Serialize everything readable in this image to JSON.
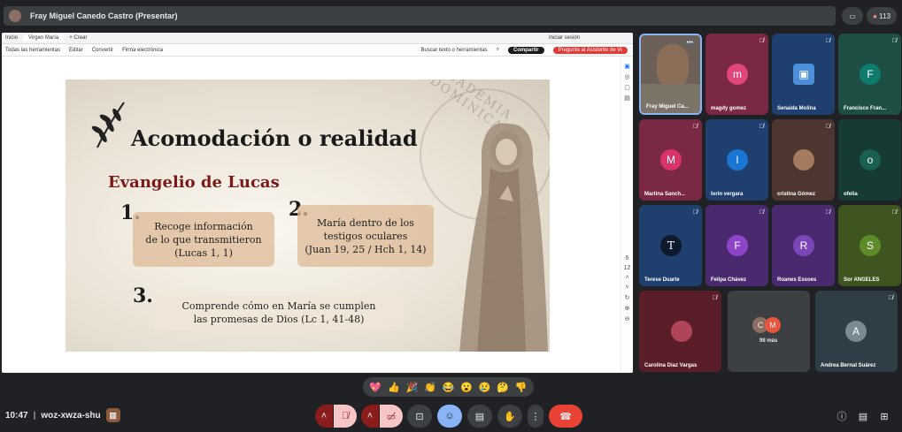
{
  "header": {
    "presenter_label": "Fray Miguel Canedo Castro (Presentar)",
    "participant_count": "113"
  },
  "browser": {
    "tabs": [
      "Inicio",
      "Virgen María",
      "+ Crear"
    ],
    "signin": "Iniciar sesión",
    "toolbar_items": [
      "Todas las herramientas",
      "Editar",
      "Convertir",
      "Firma electrónica"
    ],
    "search_placeholder": "Buscar texto o herramientas",
    "share_label": "Compartir",
    "ai_label": "Pregunte al Asistente de IA",
    "page_num": "6",
    "page_total": "12"
  },
  "slide": {
    "title": "Acomodación o realidad",
    "subtitle": "Evangelio de Lucas",
    "seal_text": "ACADEMIA DOMINICANA",
    "points": [
      {
        "num": "1.",
        "text_lines": [
          "Recoge información",
          "de lo que transmitieron",
          "(Lucas 1, 1)"
        ]
      },
      {
        "num": "2.",
        "text_lines": [
          "María dentro de los",
          "testigos oculares",
          "(Juan 19, 25 / Hch 1, 14)"
        ]
      },
      {
        "num": "3.",
        "text_lines": [
          "Comprende cómo en María se cumplen",
          "las promesas de Dios (Lc 1, 41-48)"
        ]
      }
    ]
  },
  "participants": [
    {
      "name": "Fray Miguel Ca...",
      "initial": "",
      "bg": "#6d6157",
      "circle": "",
      "video": true
    },
    {
      "name": "magdy gomez",
      "initial": "m",
      "bg": "#7b2845",
      "circle": "#e0457b"
    },
    {
      "name": "Senaida Molina",
      "initial": "",
      "bg": "#1f3f6e",
      "circle": "#4a8fd8"
    },
    {
      "name": "Francisco Fran...",
      "initial": "F",
      "bg": "#1d4f45",
      "circle": "#0f7b6c"
    },
    {
      "name": "Martina Sanch...",
      "initial": "M",
      "bg": "#7b2845",
      "circle": "#d8336b"
    },
    {
      "name": "lorin vergara",
      "initial": "l",
      "bg": "#1f3f6e",
      "circle": "#1976d2"
    },
    {
      "name": "cristina Gómez",
      "initial": "",
      "bg": "#4e3630",
      "circle": "#a57a5e"
    },
    {
      "name": "ofelia",
      "initial": "o",
      "bg": "#163b35",
      "circle": "#1b5e52"
    },
    {
      "name": "Terese Duarte",
      "initial": "T",
      "bg": "#1f3f6e",
      "circle": "#0d1a2e"
    },
    {
      "name": "Felipa Chávez",
      "initial": "F",
      "bg": "#4a2a6e",
      "circle": "#8e44c8"
    },
    {
      "name": "Roanes Essoes",
      "initial": "R",
      "bg": "#4a2a6e",
      "circle": "#7b47b8"
    },
    {
      "name": "Sor ANGELES",
      "initial": "S",
      "bg": "#3e5520",
      "circle": "#5f8c2a"
    },
    {
      "name": "Carolina Diaz Vargas",
      "initial": "",
      "bg": "#5a1e28",
      "circle": "#b0455a"
    },
    {
      "name": "98 más",
      "initial": "",
      "bg": "#3c4043",
      "circle": ""
    },
    {
      "name": "Andrea Bernal Suárez",
      "initial": "A",
      "bg": "#2f3e46",
      "circle": "#7a8a92"
    }
  ],
  "footer": {
    "time": "10:47",
    "meeting_code": "woz-xwza-shu"
  },
  "more_tile": {
    "chip1": "C",
    "chip2": "M"
  },
  "reactions": [
    "💖",
    "👍",
    "🎉",
    "👏",
    "😂",
    "😮",
    "😢",
    "🤔",
    "👎"
  ]
}
